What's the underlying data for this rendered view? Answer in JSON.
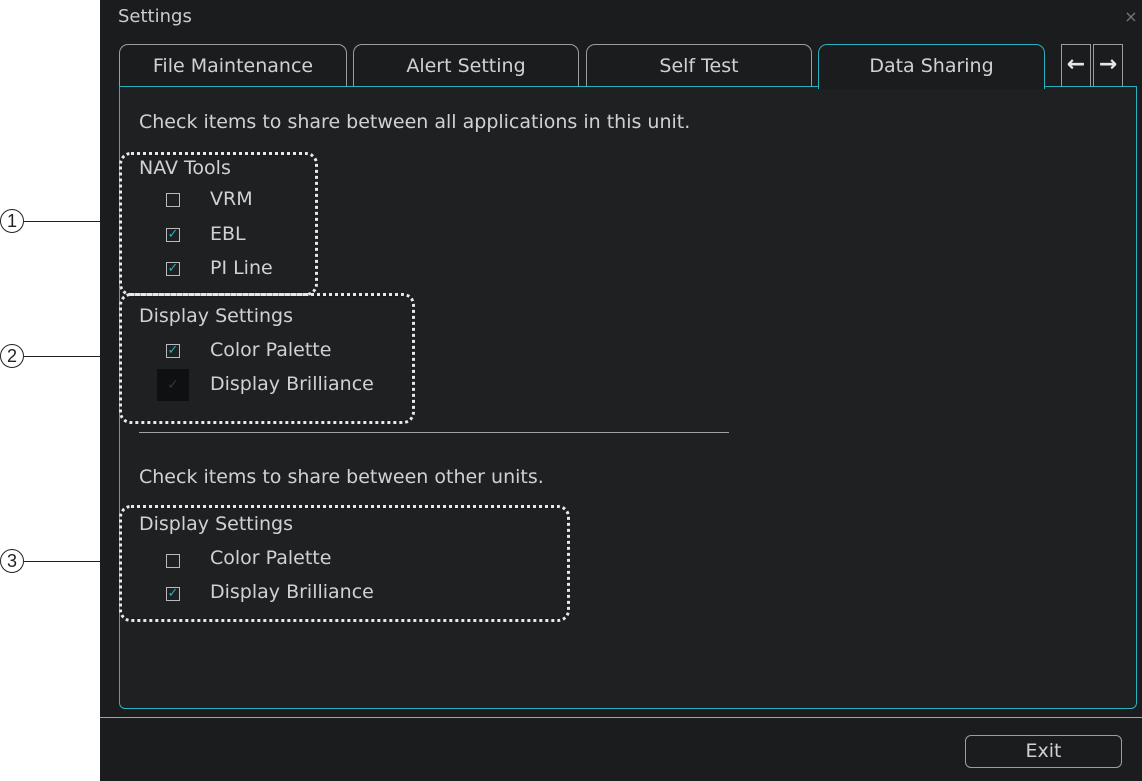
{
  "window": {
    "title": "Settings",
    "close_symbol": "×"
  },
  "tabs": [
    {
      "label": "File Maintenance",
      "active": false
    },
    {
      "label": "Alert Setting",
      "active": false
    },
    {
      "label": "Self Test",
      "active": false
    },
    {
      "label": "Data Sharing",
      "active": true
    }
  ],
  "tab_nav": {
    "prev_symbol": "←",
    "next_symbol": "→"
  },
  "section_unit": {
    "instruction": "Check items to share between all applications in this unit.",
    "nav_tools": {
      "heading": "NAV Tools",
      "items": [
        {
          "label": "VRM",
          "checked": false
        },
        {
          "label": "EBL",
          "checked": true
        },
        {
          "label": "PI Line",
          "checked": true
        }
      ]
    },
    "display_settings": {
      "heading": "Display Settings",
      "items": [
        {
          "label": "Color Palette",
          "checked": true,
          "enabled": true
        },
        {
          "label": "Display Brilliance",
          "checked": true,
          "enabled": false
        }
      ]
    }
  },
  "section_other": {
    "instruction": "Check items to share between other units.",
    "display_settings": {
      "heading": "Display Settings",
      "items": [
        {
          "label": "Color Palette",
          "checked": false
        },
        {
          "label": "Display Brilliance",
          "checked": true
        }
      ]
    }
  },
  "footer": {
    "exit_label": "Exit"
  },
  "callouts": [
    "1",
    "2",
    "3"
  ],
  "check_symbol": "✓",
  "colors": {
    "accent": "#2ab1bf",
    "background": "#1b1c1e",
    "text": "#cfd2d5"
  }
}
